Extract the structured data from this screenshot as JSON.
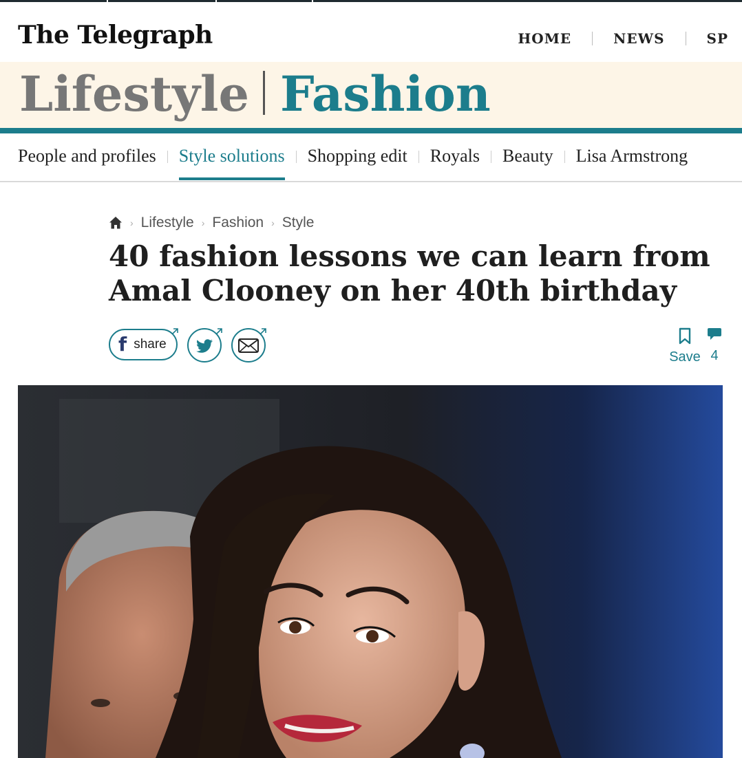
{
  "masthead": {
    "logo": "The Telegraph"
  },
  "topnav": {
    "items": [
      "HOME",
      "NEWS",
      "SP"
    ]
  },
  "section": {
    "parent": "Lifestyle",
    "current": "Fashion"
  },
  "subnav": {
    "items": [
      "People and profiles",
      "Style solutions",
      "Shopping edit",
      "Royals",
      "Beauty",
      "Lisa Armstrong"
    ],
    "active": "Style solutions"
  },
  "breadcrumb": {
    "items": [
      "Lifestyle",
      "Fashion",
      "Style"
    ]
  },
  "article": {
    "headline": "40 fashion lessons we can learn from Amal Clooney on her 40th birthday"
  },
  "share": {
    "facebook_label": "share"
  },
  "actions": {
    "save_label": "Save",
    "comment_count": "4"
  },
  "colors": {
    "accent": "#1c7d8c",
    "band": "#fdf5e7",
    "facebook": "#2a3a6d"
  }
}
